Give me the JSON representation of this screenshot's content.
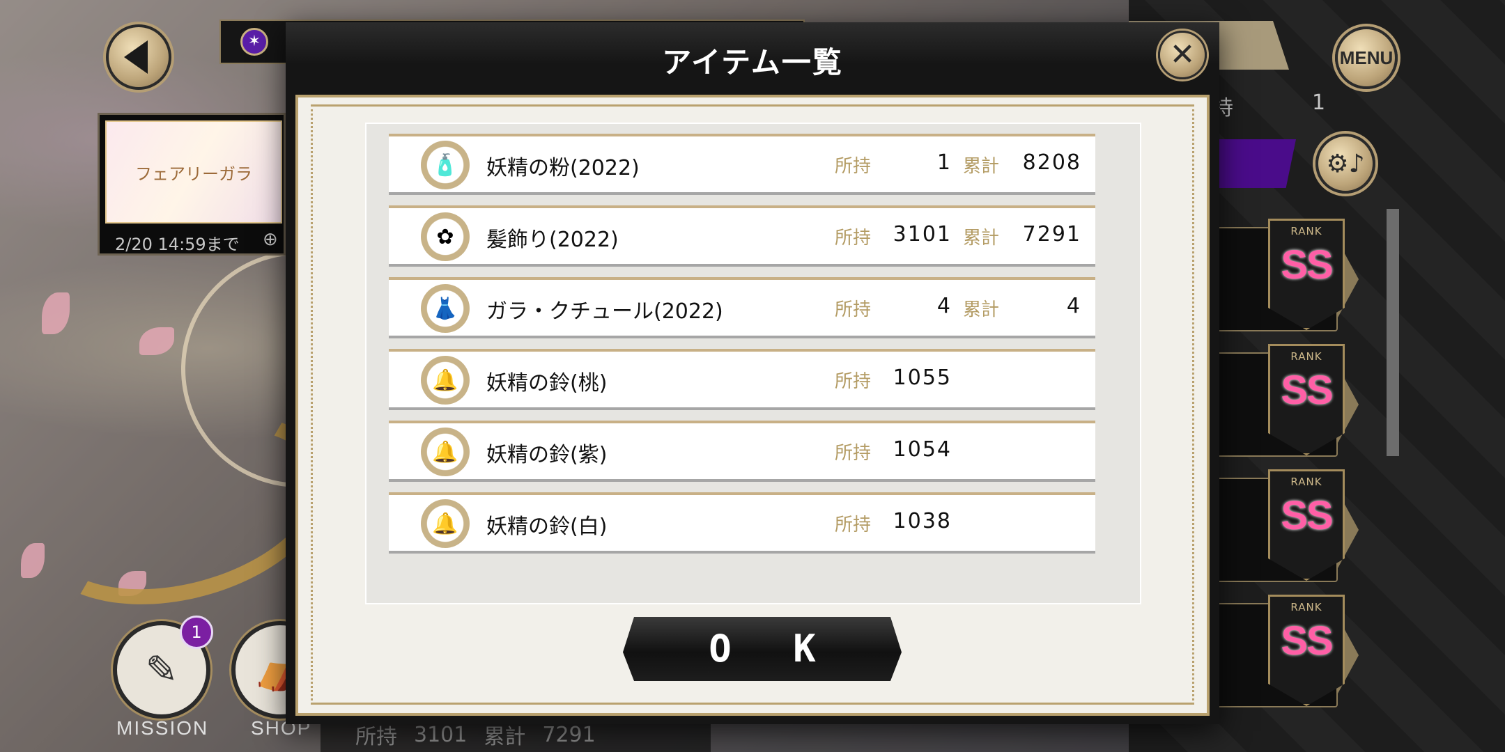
{
  "modal": {
    "title": "アイテム一覧",
    "close_symbol": "✕",
    "ok_label": "O K"
  },
  "items": [
    {
      "name": "妖精の粉(2022)",
      "hold_label": "所持",
      "hold": "1",
      "total_label": "累計",
      "total": "8208",
      "icon": "perfume-bottle-icon"
    },
    {
      "name": "髪飾り(2022)",
      "hold_label": "所持",
      "hold": "3101",
      "total_label": "累計",
      "total": "7291",
      "icon": "flower-hair-ornament-icon"
    },
    {
      "name": "ガラ・クチュール(2022)",
      "hold_label": "所持",
      "hold": "4",
      "total_label": "累計",
      "total": "4",
      "icon": "outfit-icon"
    },
    {
      "name": "妖精の鈴(桃)",
      "hold_label": "所持",
      "hold": "1055",
      "icon": "pink-bell-icon"
    },
    {
      "name": "妖精の鈴(紫)",
      "hold_label": "所持",
      "hold": "1054",
      "icon": "purple-bell-icon"
    },
    {
      "name": "妖精の鈴(白)",
      "hold_label": "所持",
      "hold": "1038",
      "icon": "white-bell-icon"
    }
  ],
  "background": {
    "menu_label": "MENU",
    "event_thumb_title": "フェアリーガラ",
    "event_deadline": "2/20 14:59まで",
    "hold_label": "持",
    "hold_value": "1",
    "rank_label": "RANK",
    "rank_value": "SS",
    "mission_label": "MISSION",
    "shop_label": "SHOP",
    "mission_badge": "1",
    "bottom_hold_label": "所持",
    "bottom_hold_value": "3101",
    "bottom_total_label": "累計",
    "bottom_total_value": "7291"
  },
  "colors": {
    "gold": "#b9a16e",
    "label_gold": "#b39b63",
    "rank_pink": "#ff5fa6",
    "badge_purple": "#7b1fa2"
  }
}
